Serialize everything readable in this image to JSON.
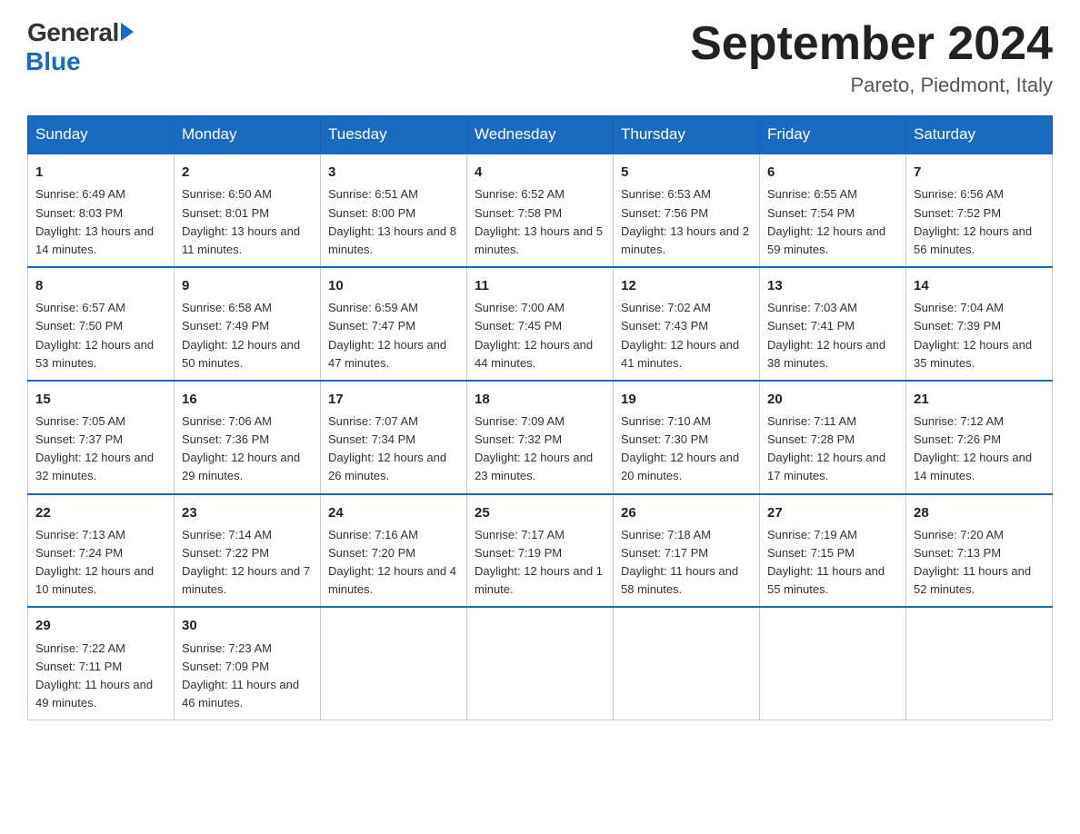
{
  "logo": {
    "general": "General",
    "blue": "Blue"
  },
  "title": "September 2024",
  "location": "Pareto, Piedmont, Italy",
  "weekdays": [
    "Sunday",
    "Monday",
    "Tuesday",
    "Wednesday",
    "Thursday",
    "Friday",
    "Saturday"
  ],
  "weeks": [
    [
      {
        "day": 1,
        "sunrise": "6:49 AM",
        "sunset": "8:03 PM",
        "daylight": "13 hours and 14 minutes."
      },
      {
        "day": 2,
        "sunrise": "6:50 AM",
        "sunset": "8:01 PM",
        "daylight": "13 hours and 11 minutes."
      },
      {
        "day": 3,
        "sunrise": "6:51 AM",
        "sunset": "8:00 PM",
        "daylight": "13 hours and 8 minutes."
      },
      {
        "day": 4,
        "sunrise": "6:52 AM",
        "sunset": "7:58 PM",
        "daylight": "13 hours and 5 minutes."
      },
      {
        "day": 5,
        "sunrise": "6:53 AM",
        "sunset": "7:56 PM",
        "daylight": "13 hours and 2 minutes."
      },
      {
        "day": 6,
        "sunrise": "6:55 AM",
        "sunset": "7:54 PM",
        "daylight": "12 hours and 59 minutes."
      },
      {
        "day": 7,
        "sunrise": "6:56 AM",
        "sunset": "7:52 PM",
        "daylight": "12 hours and 56 minutes."
      }
    ],
    [
      {
        "day": 8,
        "sunrise": "6:57 AM",
        "sunset": "7:50 PM",
        "daylight": "12 hours and 53 minutes."
      },
      {
        "day": 9,
        "sunrise": "6:58 AM",
        "sunset": "7:49 PM",
        "daylight": "12 hours and 50 minutes."
      },
      {
        "day": 10,
        "sunrise": "6:59 AM",
        "sunset": "7:47 PM",
        "daylight": "12 hours and 47 minutes."
      },
      {
        "day": 11,
        "sunrise": "7:00 AM",
        "sunset": "7:45 PM",
        "daylight": "12 hours and 44 minutes."
      },
      {
        "day": 12,
        "sunrise": "7:02 AM",
        "sunset": "7:43 PM",
        "daylight": "12 hours and 41 minutes."
      },
      {
        "day": 13,
        "sunrise": "7:03 AM",
        "sunset": "7:41 PM",
        "daylight": "12 hours and 38 minutes."
      },
      {
        "day": 14,
        "sunrise": "7:04 AM",
        "sunset": "7:39 PM",
        "daylight": "12 hours and 35 minutes."
      }
    ],
    [
      {
        "day": 15,
        "sunrise": "7:05 AM",
        "sunset": "7:37 PM",
        "daylight": "12 hours and 32 minutes."
      },
      {
        "day": 16,
        "sunrise": "7:06 AM",
        "sunset": "7:36 PM",
        "daylight": "12 hours and 29 minutes."
      },
      {
        "day": 17,
        "sunrise": "7:07 AM",
        "sunset": "7:34 PM",
        "daylight": "12 hours and 26 minutes."
      },
      {
        "day": 18,
        "sunrise": "7:09 AM",
        "sunset": "7:32 PM",
        "daylight": "12 hours and 23 minutes."
      },
      {
        "day": 19,
        "sunrise": "7:10 AM",
        "sunset": "7:30 PM",
        "daylight": "12 hours and 20 minutes."
      },
      {
        "day": 20,
        "sunrise": "7:11 AM",
        "sunset": "7:28 PM",
        "daylight": "12 hours and 17 minutes."
      },
      {
        "day": 21,
        "sunrise": "7:12 AM",
        "sunset": "7:26 PM",
        "daylight": "12 hours and 14 minutes."
      }
    ],
    [
      {
        "day": 22,
        "sunrise": "7:13 AM",
        "sunset": "7:24 PM",
        "daylight": "12 hours and 10 minutes."
      },
      {
        "day": 23,
        "sunrise": "7:14 AM",
        "sunset": "7:22 PM",
        "daylight": "12 hours and 7 minutes."
      },
      {
        "day": 24,
        "sunrise": "7:16 AM",
        "sunset": "7:20 PM",
        "daylight": "12 hours and 4 minutes."
      },
      {
        "day": 25,
        "sunrise": "7:17 AM",
        "sunset": "7:19 PM",
        "daylight": "12 hours and 1 minute."
      },
      {
        "day": 26,
        "sunrise": "7:18 AM",
        "sunset": "7:17 PM",
        "daylight": "11 hours and 58 minutes."
      },
      {
        "day": 27,
        "sunrise": "7:19 AM",
        "sunset": "7:15 PM",
        "daylight": "11 hours and 55 minutes."
      },
      {
        "day": 28,
        "sunrise": "7:20 AM",
        "sunset": "7:13 PM",
        "daylight": "11 hours and 52 minutes."
      }
    ],
    [
      {
        "day": 29,
        "sunrise": "7:22 AM",
        "sunset": "7:11 PM",
        "daylight": "11 hours and 49 minutes."
      },
      {
        "day": 30,
        "sunrise": "7:23 AM",
        "sunset": "7:09 PM",
        "daylight": "11 hours and 46 minutes."
      },
      null,
      null,
      null,
      null,
      null
    ]
  ]
}
